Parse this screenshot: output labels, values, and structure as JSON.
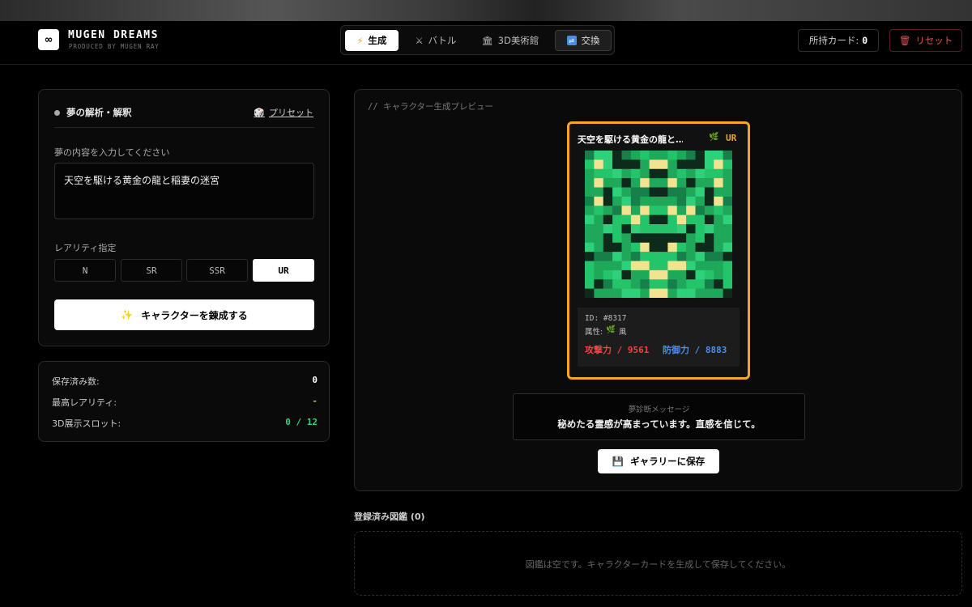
{
  "header": {
    "logo_symbol": "∞",
    "brand": "MUGEN DREAMS",
    "brand_sub": "PRODUCED BY MUGEN RAY",
    "nav": [
      {
        "label": "生成",
        "icon": "lightning-icon",
        "active": true
      },
      {
        "label": "バトル",
        "icon": "crossed-swords-icon",
        "active": false
      },
      {
        "label": "3D美術館",
        "icon": "museum-icon",
        "active": false
      },
      {
        "label": "交換",
        "icon": "exchange-icon",
        "active": false
      }
    ],
    "cards_owned_label": "所持カード:",
    "cards_owned_value": "0",
    "reset_label": "リセット"
  },
  "dream_panel": {
    "title": "夢の解析・解釈",
    "preset_label": "プリセット",
    "input_label": "夢の内容を入力してください",
    "input_value": "天空を駆ける黄金の龍と稲妻の迷宮",
    "rarity_label": "レアリティ指定",
    "rarities": [
      "N",
      "SR",
      "SSR",
      "UR"
    ],
    "selected_rarity": "UR",
    "forge_label": "キャラクターを錬成する"
  },
  "stats": {
    "saved_label": "保存済み数:",
    "saved_value": "0",
    "top_rarity_label": "最高レアリティ:",
    "top_rarity_value": "-",
    "slots_label": "3D展示スロット:",
    "slots_value": "0 / 12"
  },
  "preview": {
    "heading": "// キャラクター生成プレビュー",
    "card": {
      "title": "天空を駆ける黄金の龍と…",
      "element_icon": "leaf-icon",
      "rarity": "UR",
      "id_text": "ID: #8317",
      "attr_label": "属性:",
      "attr_value": "風",
      "atk_text": "攻撃力 / 9561",
      "def_text": "防御力 / 8883",
      "border_color": "#f5a623"
    },
    "diagnosis_label": "夢診断メッセージ",
    "diagnosis_message": "秘めたる霊感が高まっています。直感を信じて。",
    "save_label": "ギャラリーに保存"
  },
  "gallery": {
    "title": "登録済み図鑑 (0)",
    "empty_message": "図鑑は空です。キャラクターカードを生成して保存してください。"
  },
  "colors": {
    "accent": "#f5a623",
    "attack": "#ef4444",
    "defense": "#4a8fe8",
    "slots": "#3ecf7a",
    "reset": "#e05252"
  }
}
